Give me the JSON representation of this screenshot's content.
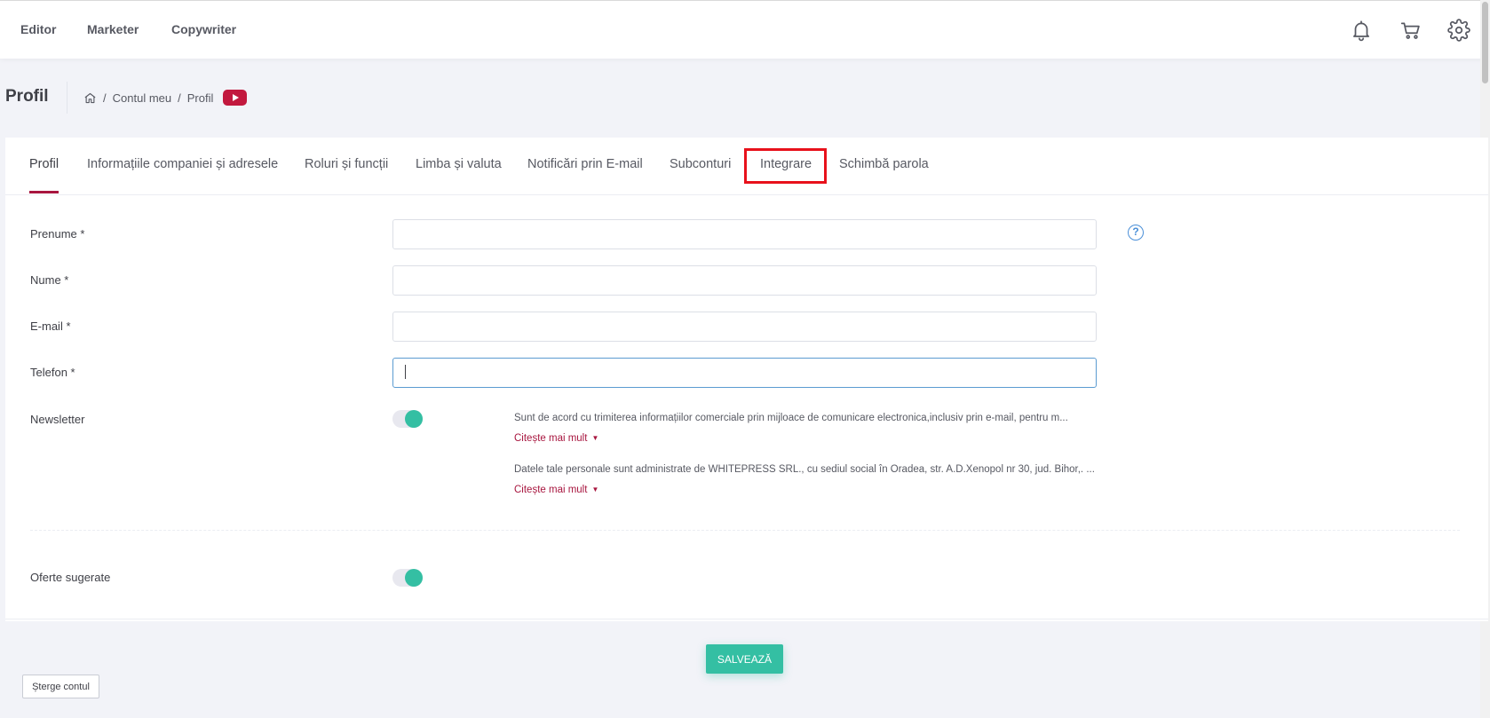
{
  "topnav": {
    "items": [
      "Editor",
      "Marketer",
      "Copywriter"
    ],
    "icons": [
      "bell-icon",
      "cart-icon",
      "gear-icon"
    ]
  },
  "subheader": {
    "title": "Profil",
    "breadcrumb": [
      "Contul meu",
      "Profil"
    ],
    "separator": "/"
  },
  "tabs": [
    "Profil",
    "Informațiile companiei și adresele",
    "Roluri și funcții",
    "Limba și valuta",
    "Notificări prin E-mail",
    "Subconturi",
    "Integrare",
    "Schimbă parola"
  ],
  "active_tab": "Profil",
  "highlighted_tab": "Integrare",
  "form": {
    "prenume_label": "Prenume *",
    "prenume_value": "",
    "nume_label": "Nume *",
    "nume_value": "",
    "email_label": "E-mail *",
    "email_value": "",
    "telefon_label": "Telefon *",
    "telefon_value": "",
    "help_icon": "?",
    "newsletter_label": "Newsletter",
    "newsletter_on": true,
    "consent_1": "Sunt de acord cu trimiterea informațiilor comerciale prin mijloace de comunicare electronica,inclusiv prin e-mail, pentru m...",
    "consent_2": "Datele tale personale sunt administrate de WHITEPRESS SRL., cu sediul social în Oradea, str. A.D.Xenopol nr 30, jud. Bihor,. ...",
    "read_more": "Citește mai mult",
    "oferte_label": "Oferte sugerate",
    "oferte_on": true
  },
  "buttons": {
    "save": "SALVEAZĂ",
    "delete": "Șterge contul"
  },
  "colors": {
    "accent": "#a8163f",
    "success": "#34bfa3",
    "highlight": "#e8111b",
    "youtube": "#c2183e"
  }
}
